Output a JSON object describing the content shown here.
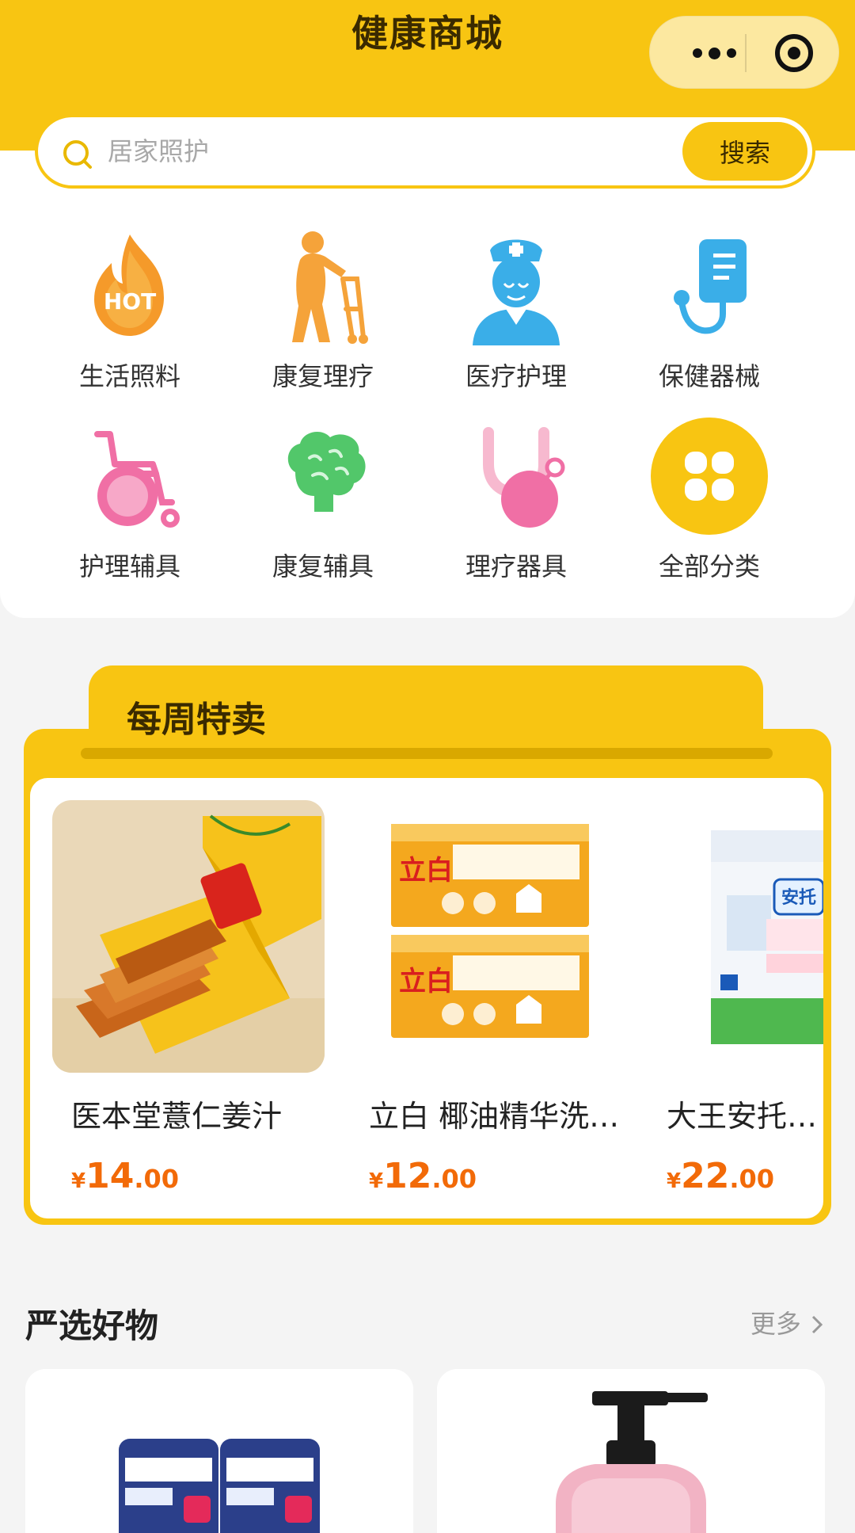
{
  "header": {
    "title": "健康商城"
  },
  "search": {
    "placeholder": "居家照护",
    "button": "搜索"
  },
  "categories": [
    {
      "label": "生活照料",
      "icon": "hot-flame-icon",
      "badge": "HOT"
    },
    {
      "label": "康复理疗",
      "icon": "elderly-walker-icon"
    },
    {
      "label": "医疗护理",
      "icon": "nurse-icon"
    },
    {
      "label": "保健器械",
      "icon": "iv-stethoscope-icon"
    },
    {
      "label": "护理辅具",
      "icon": "wheelchair-icon"
    },
    {
      "label": "康复辅具",
      "icon": "brain-icon"
    },
    {
      "label": "理疗器具",
      "icon": "stethoscope-icon"
    },
    {
      "label": "全部分类",
      "icon": "grid-all-icon"
    }
  ],
  "weekly": {
    "title": "每周特卖",
    "deals": [
      {
        "name": "医本堂薏仁姜汁",
        "currency": "¥",
        "price_int": "14",
        "price_dec": ".00"
      },
      {
        "name": "立白 椰油精华洗衣皂",
        "currency": "¥",
        "price_int": "12",
        "price_dec": ".00",
        "brand_text": "立白"
      },
      {
        "name": "大王安托短裤式成人纸尿裤",
        "currency": "¥",
        "price_int": "22",
        "price_dec": ".00",
        "brand_text": "安托"
      }
    ]
  },
  "selected": {
    "title": "严选好物",
    "more": "更多"
  },
  "colors": {
    "brand": "#f8c512",
    "price": "#f26a08"
  }
}
